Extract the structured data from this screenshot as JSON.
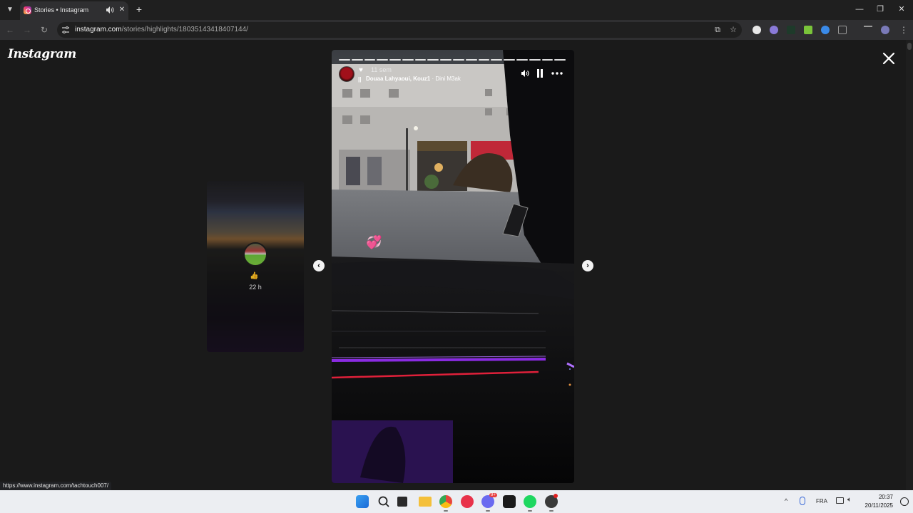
{
  "browser": {
    "tab": {
      "title": "Stories • Instagram"
    },
    "address": {
      "host": "instagram.com",
      "path": "/stories/highlights/18035143418407144/"
    },
    "status_url": "https://www.instagram.com/tachtouch007/"
  },
  "page": {
    "logo": "Instagram",
    "previous_story": {
      "time": "22 h",
      "emoji": "👍"
    },
    "story": {
      "segments": 18,
      "time": "11 sem",
      "music": {
        "artists": "Douaa Lahyaoui, Kouz1",
        "separator": " · ",
        "song": "Dini M3ak"
      },
      "sticker": "💞"
    }
  },
  "taskbar": {
    "language": "FRA",
    "time": "20:37",
    "date": "20/11/2025",
    "discord_badge": "9+"
  },
  "colors": {
    "chrome_dark": "#1f1f1f",
    "toolbar": "#2f2f31",
    "page_bg": "#1a1a1a",
    "taskbar": "#eceef2",
    "ambient_purple": "#8a2be2",
    "dash_red": "#e0203a"
  }
}
